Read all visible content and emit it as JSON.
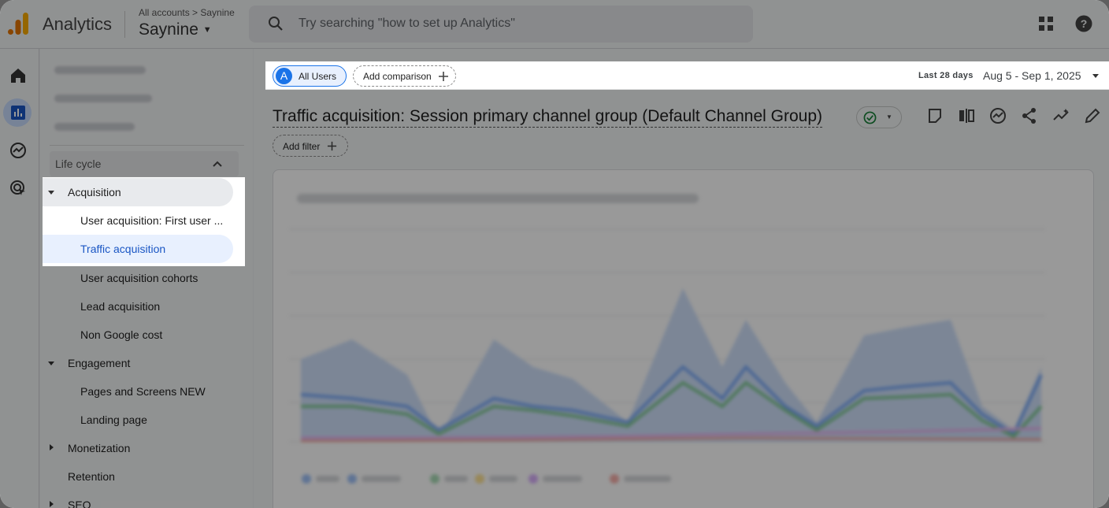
{
  "header": {
    "app_name": "Analytics",
    "breadcrumb": "All accounts > Saynine",
    "property": "Saynine",
    "search_placeholder": "Try searching \"how to set up Analytics\""
  },
  "nav": {
    "section_label": "Life cycle",
    "items": [
      {
        "label": "Acquisition"
      },
      {
        "label": "User acquisition: First user ..."
      },
      {
        "label": "Traffic acquisition"
      },
      {
        "label": "User acquisition cohorts"
      },
      {
        "label": "Lead acquisition"
      },
      {
        "label": "Non Google cost"
      },
      {
        "label": "Engagement"
      },
      {
        "label": "Pages and Screens NEW"
      },
      {
        "label": "Landing page"
      },
      {
        "label": "Monetization"
      },
      {
        "label": "Retention"
      },
      {
        "label": "SEO"
      }
    ]
  },
  "comparison": {
    "segment_badge": "A",
    "segment_label": "All Users",
    "add_comparison_label": "Add comparison",
    "range_label": "Last 28 days",
    "range_value": "Aug 5 - Sep 1, 2025"
  },
  "report": {
    "title": "Traffic acquisition: Session primary channel group (Default Channel Group)",
    "add_filter_label": "Add filter"
  },
  "colors": {
    "accent": "#1a73e8",
    "selected_bg": "#e8f0fe",
    "series": [
      "#4285f4",
      "#34a853",
      "#fbbc04",
      "#9c27b0",
      "#ea4335"
    ]
  }
}
